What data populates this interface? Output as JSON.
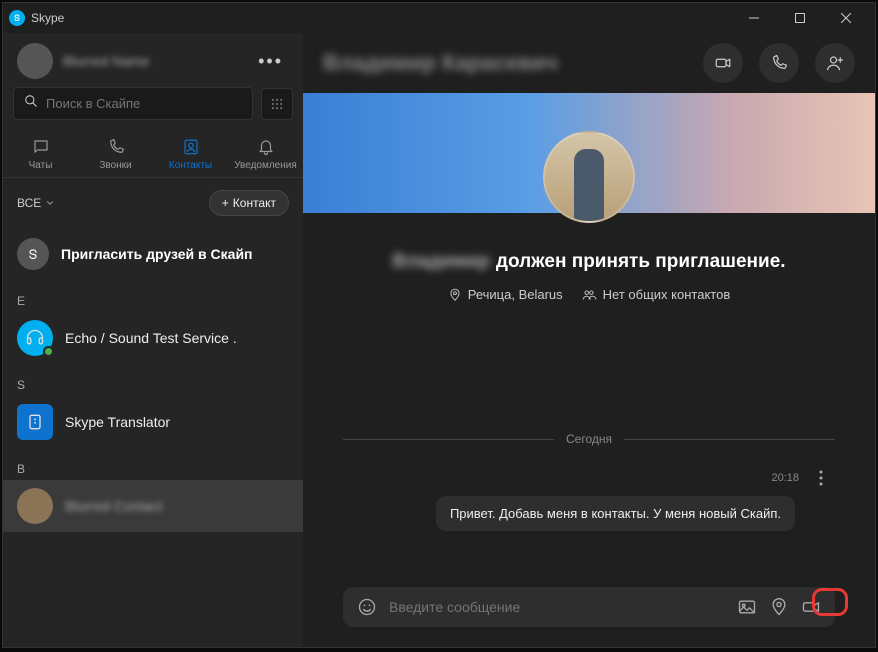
{
  "window": {
    "title": "Skype"
  },
  "profile": {
    "name": "Blurred Name"
  },
  "search": {
    "placeholder": "Поиск в Скайпе"
  },
  "tabs": {
    "chats": "Чаты",
    "calls": "Звонки",
    "contacts": "Контакты",
    "notifications": "Уведомления"
  },
  "filter": {
    "all": "ВСЕ",
    "add_contact": "Контакт"
  },
  "sidebar": {
    "invite": "Пригласить друзей в Скайп",
    "sections": {
      "E": "E",
      "S": "S",
      "V": "В"
    },
    "echo": "Echo / Sound Test Service .",
    "translator": "Skype Translator",
    "selected_contact": "Blurred Contact"
  },
  "chat": {
    "title": "Владимир Карасевич",
    "pending_prefix": "Владимир",
    "pending_suffix": "должен принять приглашение.",
    "location": "Речица, Belarus",
    "mutual": "Нет общих контактов",
    "date": "Сегодня",
    "time": "20:18",
    "message": "Привет. Добавь меня в контакты. У меня новый Скайп.",
    "input_placeholder": "Введите сообщение"
  }
}
